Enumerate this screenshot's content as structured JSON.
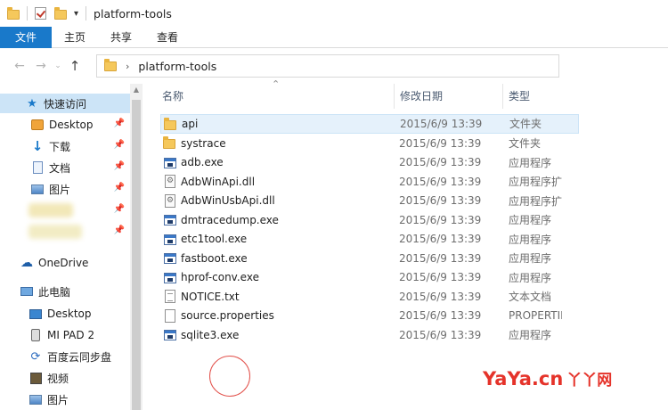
{
  "window": {
    "title": "platform-tools"
  },
  "ribbon": {
    "tabs": [
      "文件",
      "主页",
      "共享",
      "查看"
    ]
  },
  "address": {
    "path": "platform-tools"
  },
  "navpane": {
    "quick_access": "快速访问",
    "items": [
      {
        "label": "Desktop",
        "icon": "desktop-icon",
        "pinned": true
      },
      {
        "label": "下载",
        "icon": "download-arrow-icon",
        "pinned": true
      },
      {
        "label": "文档",
        "icon": "document-icon",
        "pinned": true
      },
      {
        "label": "图片",
        "icon": "picture-icon",
        "pinned": true
      }
    ],
    "onedrive": "OneDrive",
    "this_pc": "此电脑",
    "pc_items": [
      {
        "label": "Desktop",
        "icon": "desktop-icon"
      },
      {
        "label": "MI PAD 2",
        "icon": "device-icon"
      },
      {
        "label": "百度云同步盘",
        "icon": "cloud-sync-icon"
      },
      {
        "label": "视频",
        "icon": "video-icon"
      },
      {
        "label": "图片",
        "icon": "picture-icon"
      }
    ]
  },
  "columns": {
    "name": "名称",
    "date": "修改日期",
    "type": "类型"
  },
  "files": [
    {
      "name": "api",
      "date": "2015/6/9 13:39",
      "type": "文件夹",
      "icon": "folder-icon"
    },
    {
      "name": "systrace",
      "date": "2015/6/9 13:39",
      "type": "文件夹",
      "icon": "folder-icon"
    },
    {
      "name": "adb.exe",
      "date": "2015/6/9 13:39",
      "type": "应用程序",
      "icon": "exe-icon"
    },
    {
      "name": "AdbWinApi.dll",
      "date": "2015/6/9 13:39",
      "type": "应用程序扩展",
      "icon": "dll-icon"
    },
    {
      "name": "AdbWinUsbApi.dll",
      "date": "2015/6/9 13:39",
      "type": "应用程序扩展",
      "icon": "dll-icon"
    },
    {
      "name": "dmtracedump.exe",
      "date": "2015/6/9 13:39",
      "type": "应用程序",
      "icon": "exe-icon"
    },
    {
      "name": "etc1tool.exe",
      "date": "2015/6/9 13:39",
      "type": "应用程序",
      "icon": "exe-icon"
    },
    {
      "name": "fastboot.exe",
      "date": "2015/6/9 13:39",
      "type": "应用程序",
      "icon": "exe-icon"
    },
    {
      "name": "hprof-conv.exe",
      "date": "2015/6/9 13:39",
      "type": "应用程序",
      "icon": "exe-icon"
    },
    {
      "name": "NOTICE.txt",
      "date": "2015/6/9 13:39",
      "type": "文本文档",
      "icon": "txt-icon"
    },
    {
      "name": "source.properties",
      "date": "2015/6/9 13:39",
      "type": "PROPERTIES",
      "icon": "file-icon"
    },
    {
      "name": "sqlite3.exe",
      "date": "2015/6/9 13:39",
      "type": "应用程序",
      "icon": "exe-icon"
    }
  ],
  "watermark": {
    "text": "YaYa.cn",
    "suffix": "丫丫网"
  },
  "colors": {
    "accent": "#1979ca",
    "selection": "#cce4f7",
    "watermark": "#e5332a",
    "folder": "#f5c85c"
  }
}
